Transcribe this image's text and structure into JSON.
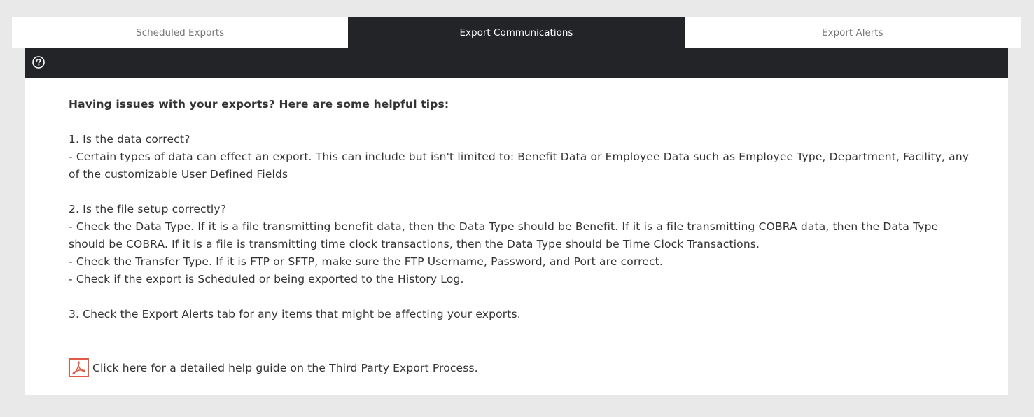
{
  "tabs": [
    {
      "label": "Scheduled Exports"
    },
    {
      "label": "Export Communications"
    },
    {
      "label": "Export Alerts"
    }
  ],
  "content": {
    "heading": "Having issues with your exports? Here are some helpful tips:",
    "section1": {
      "title": "1. Is the data correct?",
      "lines": [
        "- Certain types of data can effect an export. This can include but isn't limited to: Benefit Data or Employee Data such as Employee Type, Department, Facility, any of the customizable User Defined Fields"
      ]
    },
    "section2": {
      "title": "2. Is the file setup correctly?",
      "lines": [
        "- Check the Data Type. If it is a file transmitting benefit data, then the Data Type should be Benefit. If it is a file transmitting COBRA data, then the Data Type should be COBRA. If it is a file is transmitting time clock transactions, then the Data Type should be Time Clock Transactions.",
        "- Check the Transfer Type. If it is FTP or SFTP, make sure the FTP Username, Password, and Port are correct.",
        "- Check if the export is Scheduled or being exported to the History Log."
      ]
    },
    "section3": {
      "title": "3. Check the Export Alerts tab for any items that might be affecting your exports."
    },
    "guide_link": "Click here for a detailed help guide on the Third Party Export Process."
  },
  "icons": {
    "help": "question-circle-icon",
    "pdf": "pdf-icon"
  },
  "colors": {
    "dark_bar": "#222428",
    "pdf_accent": "#e05a45"
  }
}
